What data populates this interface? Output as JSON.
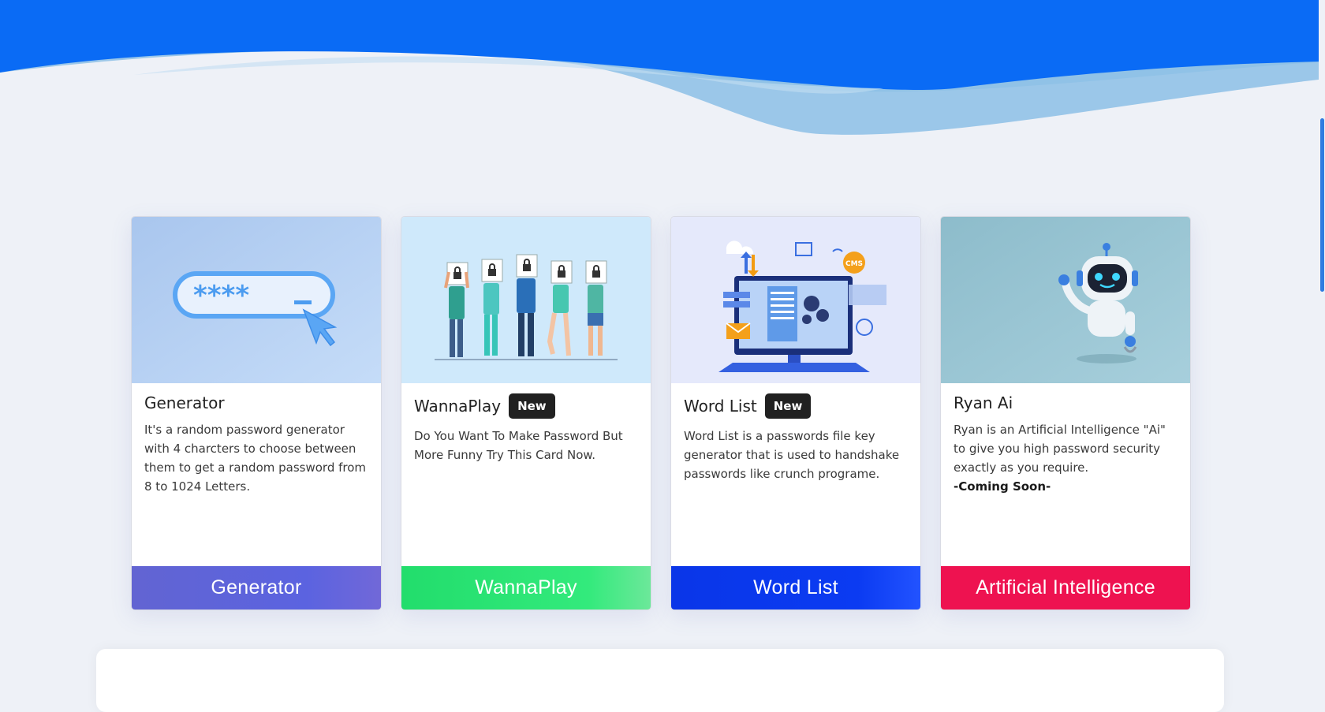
{
  "colors": {
    "header_blue": "#0a6bf5",
    "page_bg": "#eef1f7",
    "badge_bg": "#212121",
    "generator_btn": "#5b63e0",
    "wannaplay_btn": "#2ee87a",
    "wordlist_btn": "#0b3bf2",
    "ai_btn": "#ee1250"
  },
  "cards": [
    {
      "image_icon": "password-field-illustration",
      "title": "Generator",
      "badge": "",
      "description": "It's a random password generator with 4 charcters to choose between them to get a random password from 8 to 1024 Letters.",
      "extra": "",
      "button": "Generator"
    },
    {
      "image_icon": "people-holding-lock-signs-illustration",
      "title": "WannaPlay",
      "badge": "New",
      "description": "Do You Want To Make Password But More Funny Try This Card Now.",
      "extra": "",
      "button": "WannaPlay"
    },
    {
      "image_icon": "computer-cms-illustration",
      "title": "Word List",
      "badge": "New",
      "description": "Word List is a passwords file key generator that is used to handshake passwords like crunch programe.",
      "extra": "",
      "button": "Word List",
      "cms_label": "CMS"
    },
    {
      "image_icon": "robot-illustration",
      "title": "Ryan Ai",
      "badge": "",
      "description": "Ryan is an Artificial Intelligence \"Ai\" to give you high password security exactly as you require.",
      "extra": "-Coming Soon-",
      "button": "Artificial Intelligence"
    }
  ]
}
